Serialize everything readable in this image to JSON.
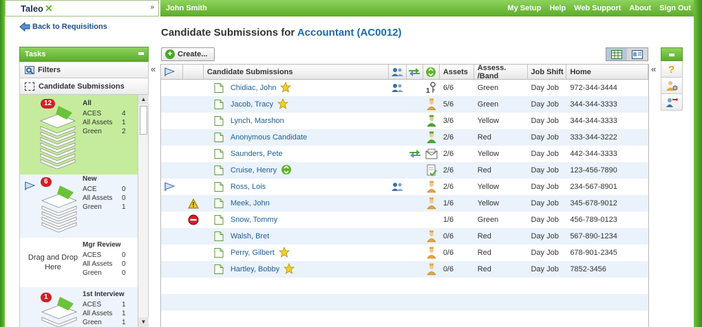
{
  "app": {
    "logo": "Taleo",
    "user": "John Smith"
  },
  "top_links": [
    "My Setup",
    "Help",
    "Web Support",
    "About",
    "Sign Out"
  ],
  "back_link": "Back to Requisitions",
  "title": {
    "prefix": "Candidate Submissions for ",
    "requisition": "Accountant (AC0012)"
  },
  "tasks": {
    "header": "Tasks",
    "filters": "Filters",
    "submissions": "Candidate Submissions",
    "steps": [
      {
        "name": "All",
        "badge": "12",
        "lines": [
          [
            "ACES",
            "4"
          ],
          [
            "All Assets",
            "1"
          ],
          [
            "Green",
            "2"
          ]
        ]
      },
      {
        "name": "New",
        "badge": "6",
        "lines": [
          [
            "ACE",
            "0"
          ],
          [
            "All Assets",
            "0"
          ],
          [
            "Green",
            "1"
          ]
        ]
      },
      {
        "name": "Mgr Review",
        "drop": "Drag and Drop Here",
        "lines": [
          [
            "ACES",
            "0"
          ],
          [
            "All Assets",
            "0"
          ],
          [
            "Green",
            "0"
          ]
        ]
      },
      {
        "name": "1st Interview",
        "badge": "1",
        "lines": [
          [
            "ACES",
            "1"
          ],
          [
            "All Assets",
            "1"
          ],
          [
            "Green",
            "1"
          ]
        ]
      }
    ]
  },
  "toolbar": {
    "create": "Create..."
  },
  "columns": {
    "submissions": "Candidate Submissions",
    "assets": "Assets",
    "band": "Assess. /Band",
    "shift": "Job Shift",
    "home": "Home"
  },
  "rows": [
    {
      "name": "Chidiac, John",
      "star": "star",
      "flag": "",
      "alert": "",
      "i1": "people",
      "i2": "",
      "i3": "key",
      "assets": "6/6",
      "band": "Green",
      "shift": "Day Job",
      "home": "972-344-3444"
    },
    {
      "name": "Jacob, Tracy",
      "star": "star",
      "flag": "",
      "alert": "",
      "i1": "",
      "i2": "",
      "i3": "person",
      "assets": "5/6",
      "band": "Green",
      "shift": "Day Job",
      "home": "344-344-3333"
    },
    {
      "name": "Lynch, Marshon",
      "star": "",
      "flag": "",
      "alert": "",
      "i1": "",
      "i2": "",
      "i3": "person-green",
      "assets": "3/6",
      "band": "Yellow",
      "shift": "Day Job",
      "home": "344-344-3333"
    },
    {
      "name": "Anonymous Candidate",
      "star": "",
      "flag": "",
      "alert": "",
      "i1": "",
      "i2": "",
      "i3": "person-green",
      "assets": "2/6",
      "band": "Red",
      "shift": "Day Job",
      "home": "333-344-3222"
    },
    {
      "name": "Saunders, Pete",
      "star": "",
      "flag": "",
      "alert": "",
      "i1": "",
      "i2": "transfer",
      "i3": "mail",
      "assets": "2/6",
      "band": "Yellow",
      "shift": "Day Job",
      "home": "442-344-3333"
    },
    {
      "name": "Cruise, Henry",
      "star": "recycle",
      "flag": "",
      "alert": "",
      "i1": "",
      "i2": "",
      "i3": "doc-check",
      "assets": "2/6",
      "band": "Red",
      "shift": "Day Job",
      "home": "123-456-7890"
    },
    {
      "name": "Ross, Lois",
      "star": "",
      "flag": "flag",
      "alert": "",
      "i1": "people",
      "i2": "",
      "i3": "person",
      "assets": "2/6",
      "band": "Yellow",
      "shift": "Day Job",
      "home": "234-567-8901"
    },
    {
      "name": "Meek, John",
      "star": "",
      "flag": "",
      "alert": "warning",
      "i1": "",
      "i2": "",
      "i3": "person",
      "assets": "1/6",
      "band": "Yellow",
      "shift": "Day Job",
      "home": "345-678-9012"
    },
    {
      "name": "Snow, Tommy",
      "star": "",
      "flag": "",
      "alert": "stop",
      "i1": "",
      "i2": "",
      "i3": "",
      "assets": "1/6",
      "band": "Green",
      "shift": "Day Job",
      "home": "456-789-0123"
    },
    {
      "name": "Walsh, Bret",
      "star": "",
      "flag": "",
      "alert": "",
      "i1": "",
      "i2": "",
      "i3": "person",
      "assets": "0/6",
      "band": "Red",
      "shift": "Day Job",
      "home": "567-890-1234"
    },
    {
      "name": "Perry, Gilbert",
      "star": "star",
      "flag": "",
      "alert": "",
      "i1": "",
      "i2": "",
      "i3": "person",
      "assets": "0/6",
      "band": "Red",
      "shift": "Day Job",
      "home": "678-901-2345"
    },
    {
      "name": "Hartley, Bobby",
      "star": "star",
      "flag": "",
      "alert": "",
      "i1": "",
      "i2": "",
      "i3": "person",
      "assets": "0/6",
      "band": "Red",
      "shift": "Day Job",
      "home": "7852-3456"
    }
  ],
  "colors": {
    "accent_green": "#6cc23a",
    "link_blue": "#1d5f95",
    "row_alt": "#eaf2fb",
    "all_step": "#c4ec9c"
  }
}
